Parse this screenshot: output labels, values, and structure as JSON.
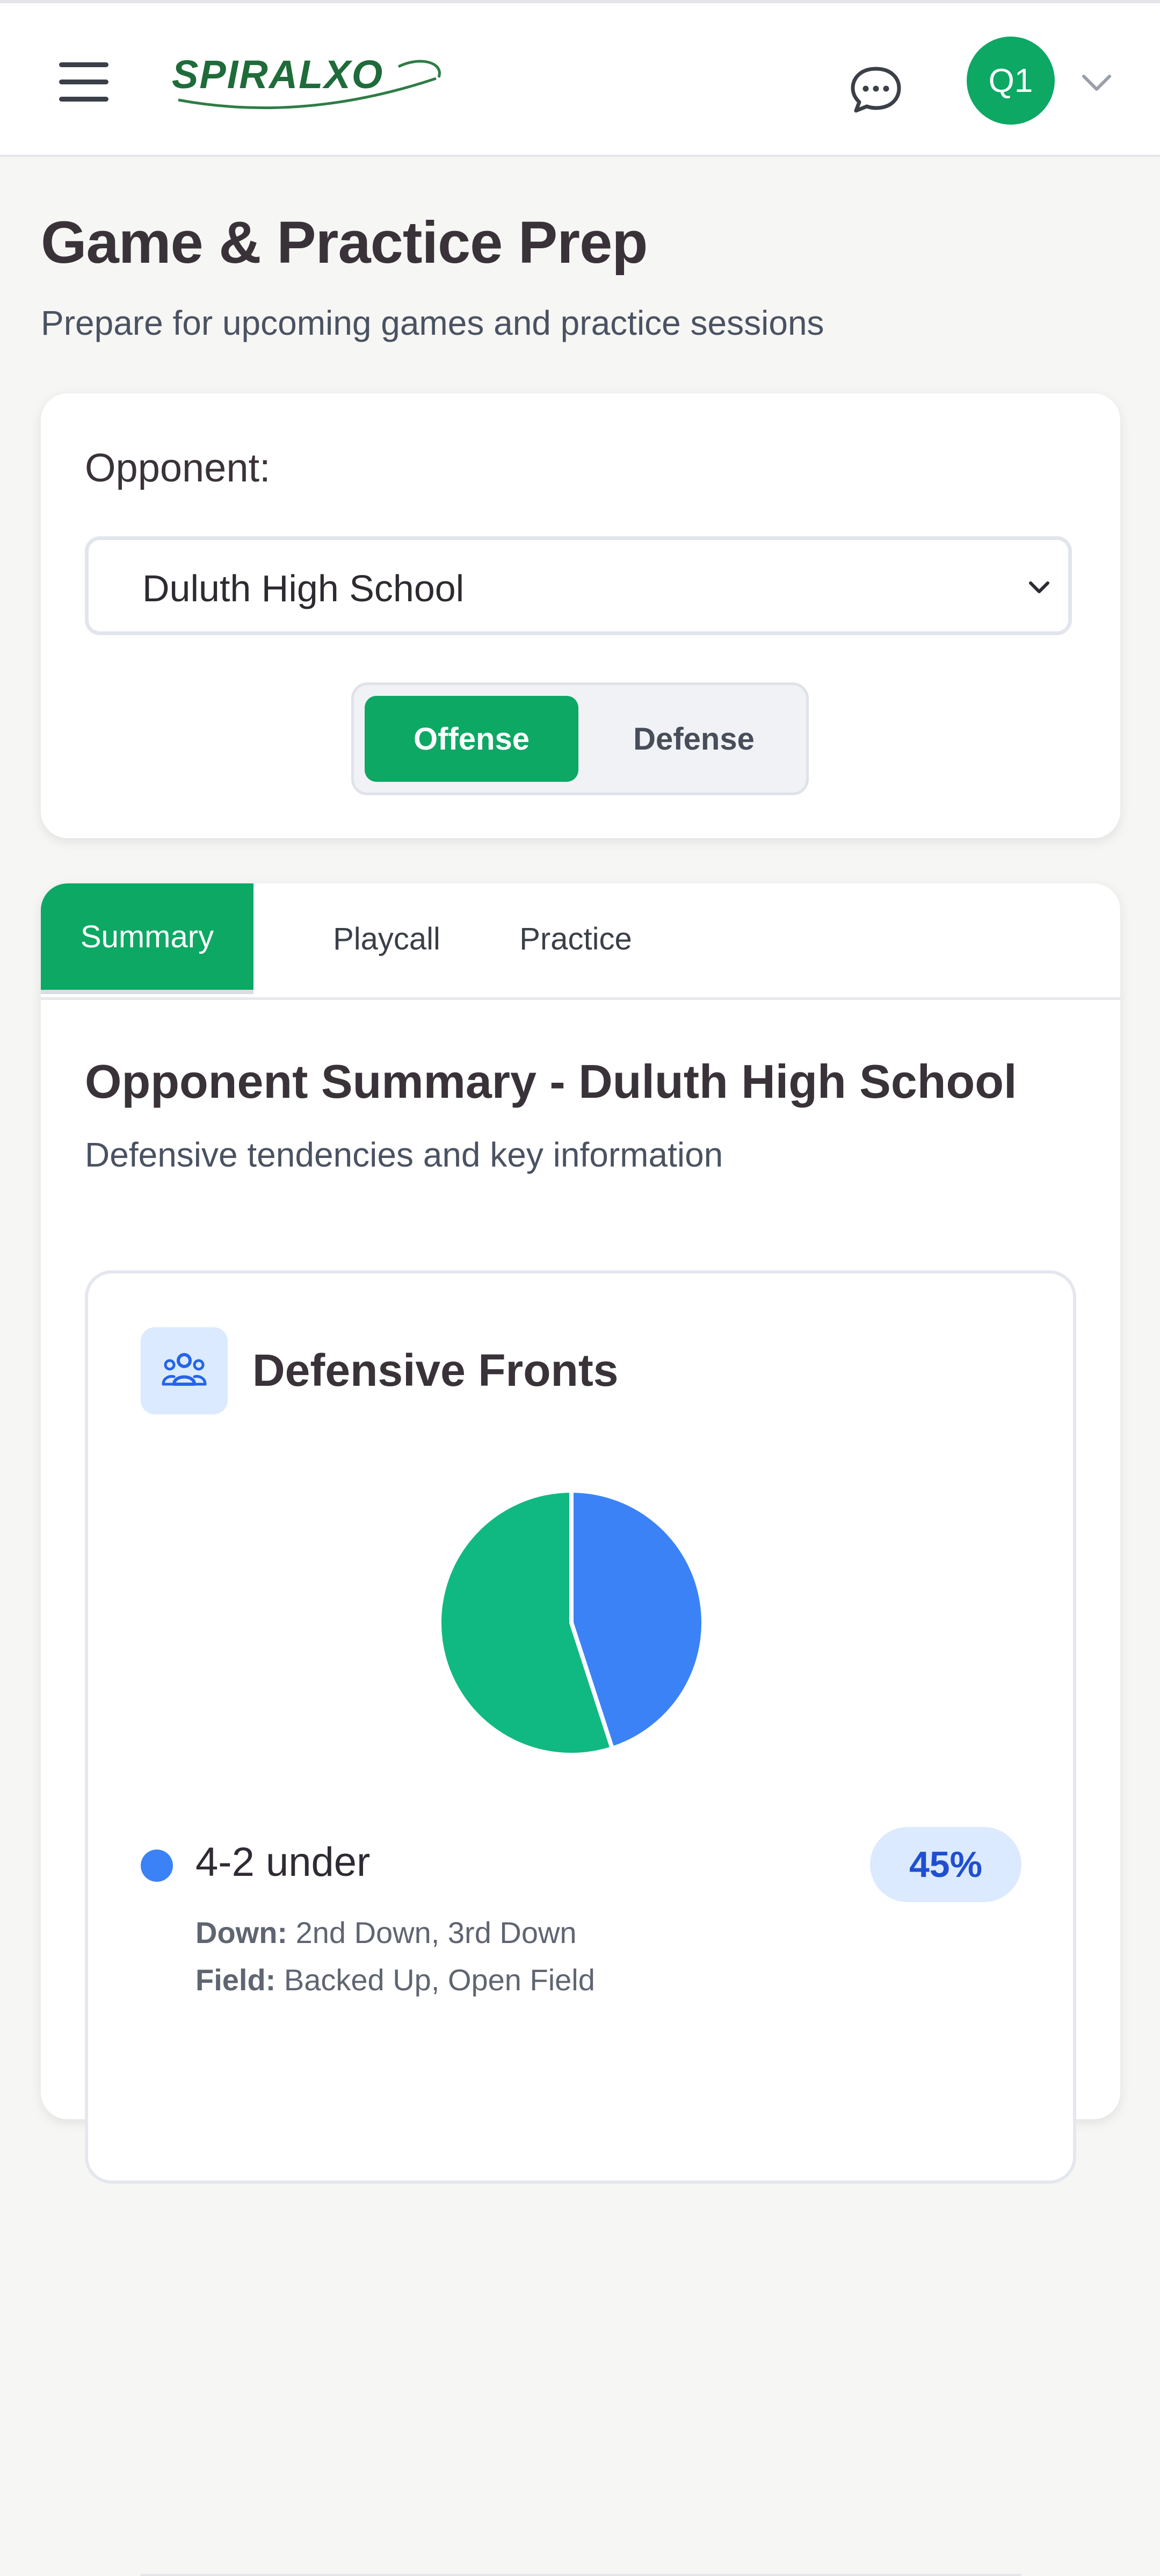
{
  "header": {
    "logo_text": "SPIRALXO",
    "avatar_initials": "Q1"
  },
  "page": {
    "title": "Game & Practice Prep",
    "subtitle": "Prepare for upcoming games and practice sessions"
  },
  "prep": {
    "opponent_label": "Opponent:",
    "opponent_selected": "Duluth High School",
    "side_toggle": {
      "options": [
        "Offense",
        "Defense"
      ],
      "active": "Offense"
    }
  },
  "tabs": {
    "items": [
      "Summary",
      "Playcall",
      "Practice"
    ],
    "active": "Summary"
  },
  "summary": {
    "title": "Opponent Summary - Duluth High School",
    "subtitle": "Defensive tendencies and key information"
  },
  "fronts": {
    "title": "Defensive Fronts",
    "legend": [
      {
        "label": "4-2 under",
        "percent_label": "45%",
        "down_label": "Down:",
        "down_value": "2nd Down, 3rd Down",
        "field_label": "Field:",
        "field_value": "Backed Up, Open Field"
      }
    ]
  },
  "colors": {
    "brand_green": "#0da864",
    "series_blue": "#3b82f6",
    "series_green": "#10b981"
  },
  "icons": {
    "menu": "hamburger-icon",
    "chat": "chat-bubble-icon",
    "avatar_dropdown": "chevron-down-icon",
    "select_dropdown": "chevron-down-icon",
    "fronts": "users-group-icon"
  },
  "chart_data": {
    "type": "pie",
    "title": "Defensive Fronts",
    "slices": [
      {
        "label": "4-2 under",
        "value": 45,
        "color": "#3b82f6"
      },
      {
        "label": "",
        "value": 55,
        "color": "#10b981"
      }
    ]
  }
}
